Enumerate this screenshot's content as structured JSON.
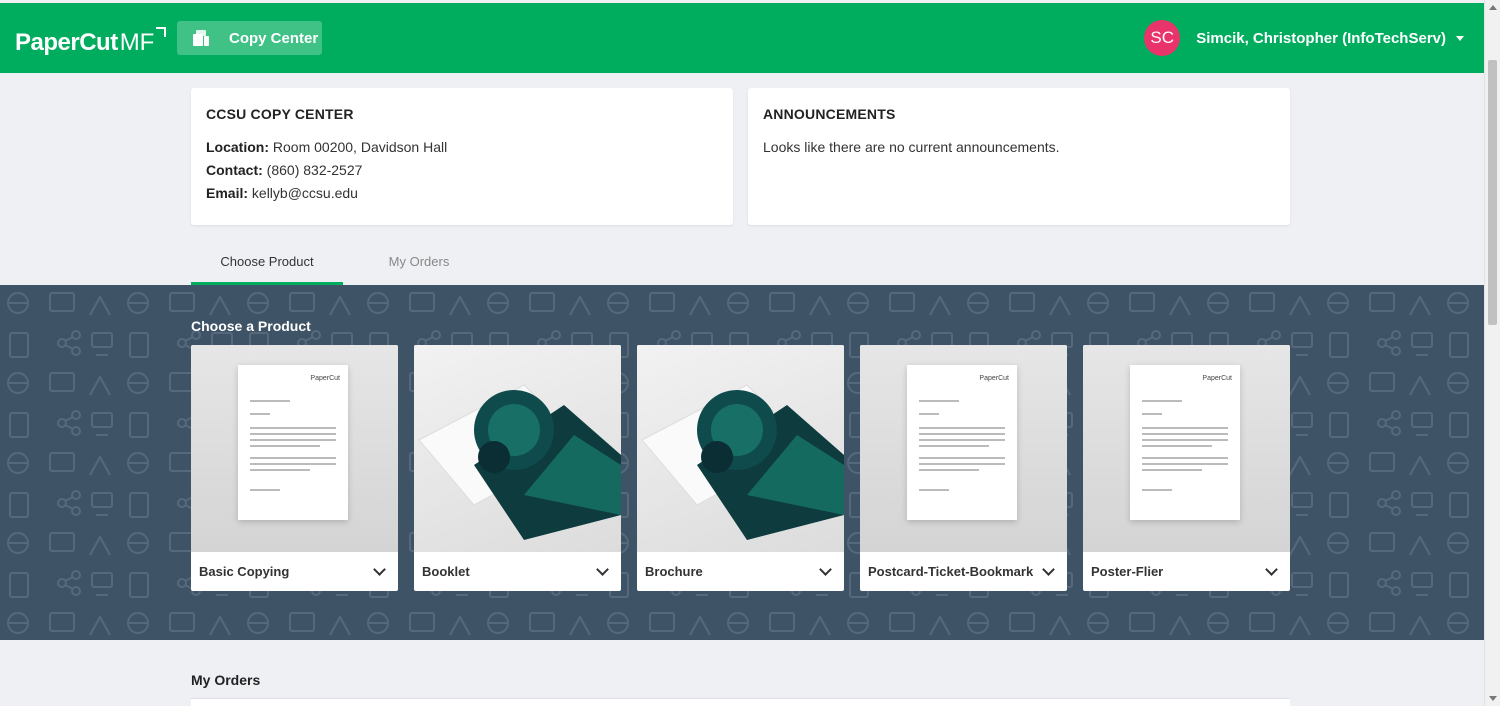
{
  "header": {
    "logo_text": "PaperCut",
    "logo_mf": "MF",
    "copy_center_label": "Copy Center",
    "user_initials": "SC",
    "user_name": "Simcik, Christopher (InfoTechServ)"
  },
  "info_card": {
    "title": "CCSU COPY CENTER",
    "location_label": "Location:",
    "location_value": "Room 00200, Davidson Hall",
    "contact_label": "Contact:",
    "contact_value": "(860) 832-2527",
    "email_label": "Email:",
    "email_value": "kellyb@ccsu.edu"
  },
  "announcements": {
    "title": "ANNOUNCEMENTS",
    "message": "Looks like there are no current announcements."
  },
  "tabs": [
    {
      "label": "Choose Product",
      "active": true
    },
    {
      "label": "My Orders",
      "active": false
    }
  ],
  "products_section": {
    "title": "Choose a Product",
    "items": [
      {
        "label": "Basic Copying",
        "thumb": "document"
      },
      {
        "label": "Booklet",
        "thumb": "brochure"
      },
      {
        "label": "Brochure",
        "thumb": "brochure"
      },
      {
        "label": "Postcard-Ticket-Bookmark",
        "thumb": "document"
      },
      {
        "label": "Poster-Flier",
        "thumb": "document"
      }
    ],
    "doc_brand": "PaperCut"
  },
  "my_orders": {
    "title": "My Orders"
  },
  "colors": {
    "header_green": "#00ad5e",
    "band": "#3f5366",
    "avatar": "#e8336b"
  }
}
